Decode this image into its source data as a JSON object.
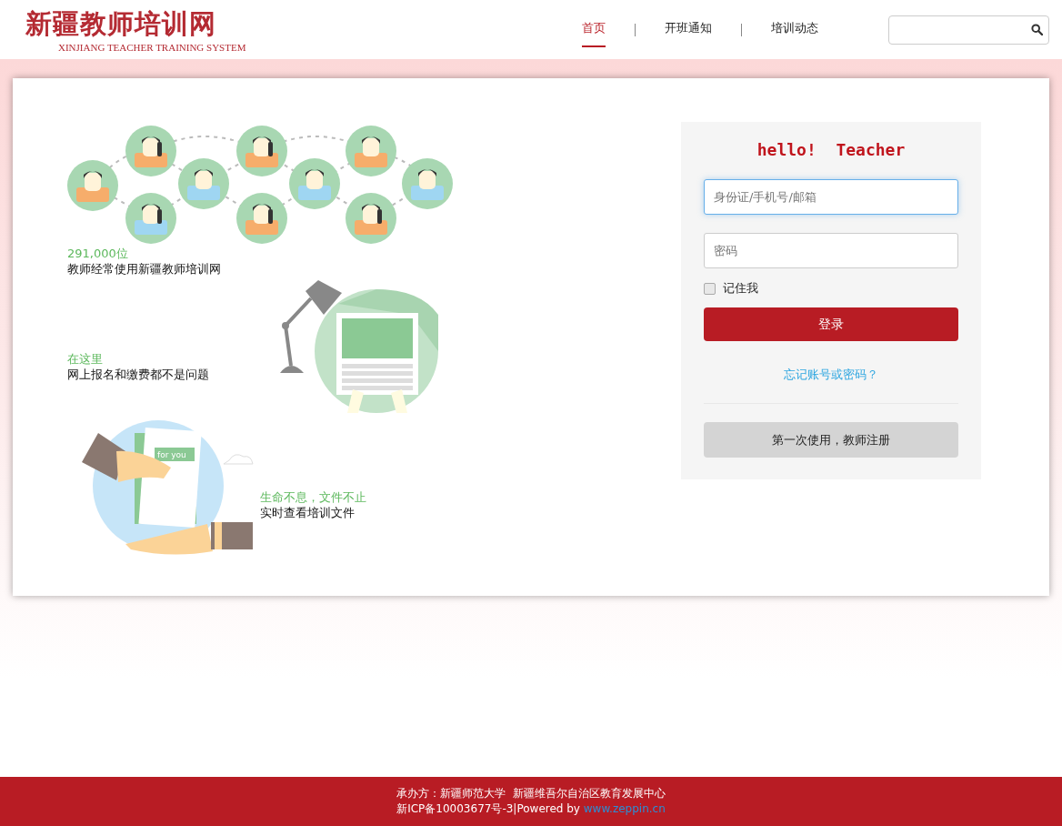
{
  "header": {
    "logo_title": "新疆教师培训网",
    "logo_subtitle": "XINJIANG TEACHER TRAINING SYSTEM",
    "nav": [
      {
        "label": "首页",
        "selected": true
      },
      {
        "label": "开班通知",
        "selected": false
      },
      {
        "label": "培训动态",
        "selected": false
      }
    ]
  },
  "features": [
    {
      "kind": "people",
      "highlight": "291,000位",
      "text": "教师经常使用新疆教师培训网"
    },
    {
      "kind": "laptop",
      "highlight": "在这里",
      "text": "网上报名和缴费都不是问题"
    },
    {
      "kind": "document",
      "highlight": "生命不息，文件不止",
      "text": "实时查看培训文件",
      "illustration_label": "for you"
    }
  ],
  "login": {
    "greeting": "hello!  Teacher",
    "username": {
      "placeholder": "身份证/手机号/邮箱",
      "focused": true
    },
    "password": {
      "placeholder": "密码"
    },
    "remember": {
      "label": "记住我",
      "checked": false
    },
    "submit": "登录",
    "forgot": "忘记账号或密码？",
    "register": "第一次使用，教师注册"
  },
  "footer": {
    "organizer": "承办方：新疆师范大学  新疆维吾尔自治区教育发展中心",
    "icp": "新ICP备10003677号-3|Powered by ",
    "powered_link": "www.zeppin.cn"
  }
}
